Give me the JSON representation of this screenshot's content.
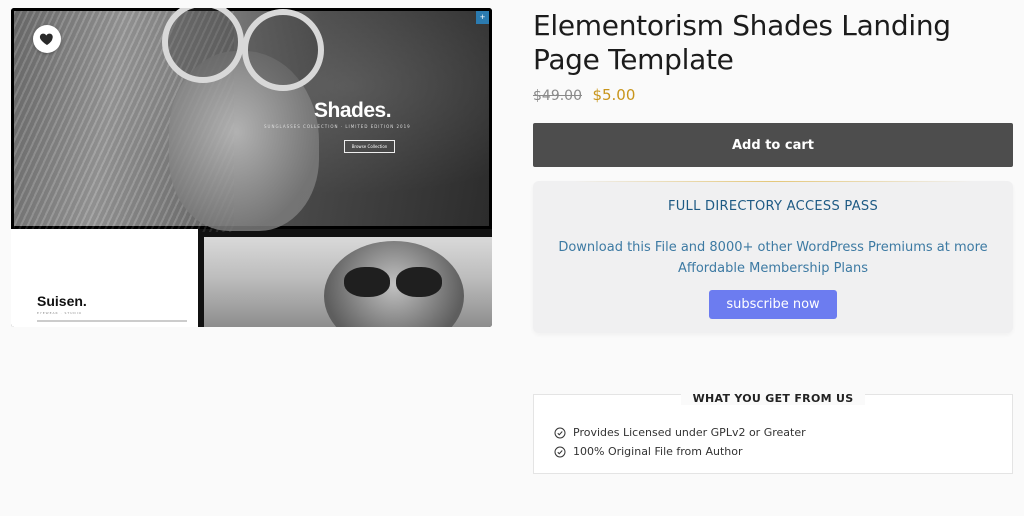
{
  "gallery": {
    "hero_brand": "Shades.",
    "hero_tagline": "SUNGLASSES COLLECTION · LIMITED EDITION 2019",
    "hero_cta": "Browse Collection",
    "secondary_brand": "Suisen.",
    "secondary_sub": "EYEWEAR · STUDIO",
    "wishlist_icon": "heart-icon",
    "corner_icon": "plus-icon"
  },
  "product": {
    "title": "Elementorism Shades Landing Page Template",
    "price_old": "$49.00",
    "price_new": "$5.00",
    "add_to_cart": "Add to cart"
  },
  "pass": {
    "heading": "FULL DIRECTORY ACCESS PASS",
    "description": "Download this File and 8000+ other WordPress Premiums at more Affordable Membership Plans",
    "button": "subscribe now"
  },
  "benefits": {
    "heading": "WHAT YOU GET FROM US",
    "items": [
      {
        "label": "Provides Licensed under GPLv2 or Greater",
        "icon": "check-circle-icon"
      },
      {
        "label": "100% Original File from Author",
        "icon": "check-circle-icon"
      }
    ]
  },
  "colors": {
    "page_bg": "#fafafa",
    "button_dark": "#4d4d4d",
    "sale_price": "#c8951b",
    "pass_heading": "#1e5a84",
    "pass_text": "#3d7aa3",
    "subscribe_btn": "#6c7cf0"
  }
}
